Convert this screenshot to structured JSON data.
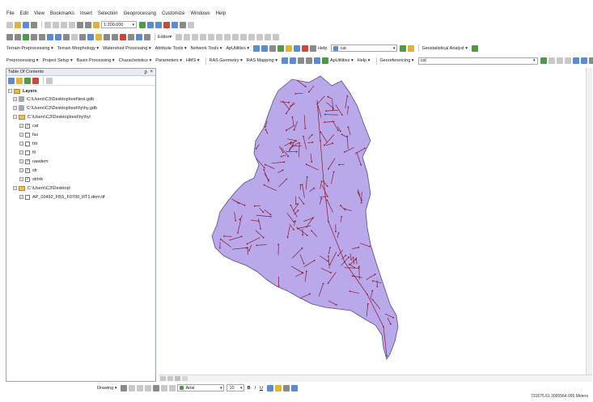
{
  "menu": [
    "File",
    "Edit",
    "View",
    "Bookmarks",
    "Insert",
    "Selection",
    "Geoprocessing",
    "Customize",
    "Windows",
    "Help"
  ],
  "toolbar1": {
    "scale": "1:200,000"
  },
  "toolbar2": {
    "editor_label": "Editor▾"
  },
  "toolbar3": {
    "items": [
      "Terrain Preprocessing ▾",
      "Terrain Morphology ▾",
      "Watershed Processing ▾",
      "Attribute Tools ▾",
      "Network Tools ▾",
      "ApUtilities ▾"
    ],
    "help": "Help",
    "layer_combo": "cat",
    "geostat": "Geostatistical Analyst ▾"
  },
  "toolbar4": {
    "items": [
      "Preprocessing ▾",
      "Project Setup ▾",
      "Basin Processing ▾",
      "Characteristics ▾",
      "Parameters ▾",
      "HMS ▾"
    ],
    "ras_items": [
      "RAS Geometry ▾",
      "RAS Mapping ▾"
    ],
    "aputil": "ApUtilities ▾",
    "help": "Help ▾",
    "georef": "Georeferencing ▾",
    "georef_combo": "cat"
  },
  "toc": {
    "title": "Table Of Contents",
    "layers_label": "Layers",
    "items": [
      {
        "label": "C:\\Users\\C3\\Desktop\\test\\test.gdb",
        "kind": "db",
        "level": 1
      },
      {
        "label": "C:\\Users\\C3\\Desktop\\test\\hy\\hy.gdb",
        "kind": "db",
        "level": 1
      },
      {
        "label": "C:\\Users\\C3\\Desktop\\test\\hy\\hy\\",
        "kind": "folder",
        "level": 1
      },
      {
        "label": "cat",
        "kind": "layer",
        "checked": true,
        "level": 2
      },
      {
        "label": "fac",
        "kind": "layer",
        "checked": false,
        "level": 2
      },
      {
        "label": "fdr",
        "kind": "layer",
        "checked": false,
        "level": 2
      },
      {
        "label": "fil",
        "kind": "layer",
        "checked": false,
        "level": 2
      },
      {
        "label": "rawdem",
        "kind": "layer",
        "checked": true,
        "level": 2
      },
      {
        "label": "str",
        "kind": "layer",
        "checked": true,
        "level": 2
      },
      {
        "label": "strlnk",
        "kind": "layer",
        "checked": true,
        "level": 2
      },
      {
        "label": "C:\\Users\\C3\\Desktop\\",
        "kind": "folder",
        "level": 1
      },
      {
        "label": "AP_00492_FBS_F0700_RT1.dem.tif",
        "kind": "layer",
        "checked": false,
        "level": 2
      }
    ]
  },
  "drawing": {
    "label": "Drawing ▾",
    "font": "Arial",
    "size": "10"
  },
  "status": "731675.61  3095564.095 Meters",
  "colors": {
    "watershed_fill": "#b9a9ea",
    "watershed_outline": "#5a4a8a",
    "streams": "#8b1c2c"
  }
}
